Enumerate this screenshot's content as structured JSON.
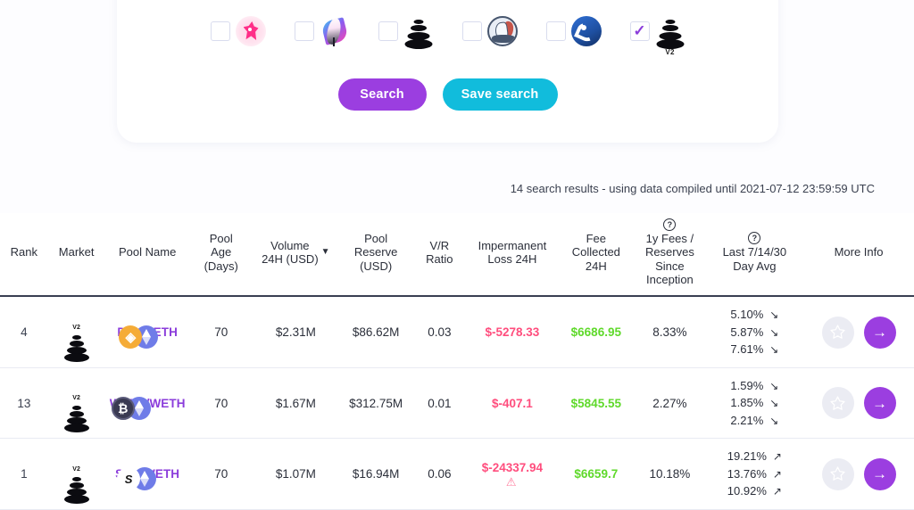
{
  "filter_panel": {
    "markets": [
      {
        "name": "uniswap-v2",
        "logo": "uniswap-logo",
        "checked": false,
        "version_tag": ""
      },
      {
        "name": "sushiswap",
        "logo": "sushiswap-logo",
        "checked": false,
        "version_tag": ""
      },
      {
        "name": "balancer-v1",
        "logo": "balancer-logo",
        "checked": false,
        "version_tag": ""
      },
      {
        "name": "dodo",
        "logo": "dodo-logo",
        "checked": false,
        "version_tag": ""
      },
      {
        "name": "bancor",
        "logo": "bancor-logo",
        "checked": false,
        "version_tag": ""
      },
      {
        "name": "balancer-v2",
        "logo": "balancer-logo",
        "checked": true,
        "version_tag": "V2"
      }
    ],
    "search_label": "Search",
    "save_search_label": "Save search"
  },
  "results_meta": "14 search results - using data compiled until 2021-07-12 23:59:59 UTC",
  "table": {
    "columns": [
      {
        "key": "rank",
        "label": "Rank",
        "help": false,
        "sorted": false
      },
      {
        "key": "market",
        "label": "Market",
        "help": false,
        "sorted": false
      },
      {
        "key": "pool_name",
        "label": "Pool Name",
        "help": false,
        "sorted": false
      },
      {
        "key": "pool_age",
        "label": "Pool\nAge\n(Days)",
        "help": false,
        "sorted": false
      },
      {
        "key": "volume_24h",
        "label": "Volume\n24H (USD)",
        "help": false,
        "sorted": true,
        "sort_caret": "▼"
      },
      {
        "key": "pool_reserve",
        "label": "Pool\nReserve\n(USD)",
        "help": false,
        "sorted": false
      },
      {
        "key": "vr_ratio",
        "label": "V/R\nRatio",
        "help": false,
        "sorted": false
      },
      {
        "key": "impermanent_loss",
        "label": "Impermanent\nLoss 24H",
        "help": false,
        "sorted": false
      },
      {
        "key": "fee_collected",
        "label": "Fee\nCollected\n24H",
        "help": false,
        "sorted": false
      },
      {
        "key": "fees_reserves",
        "label": "1y Fees /\nReserves\nSince\nInception",
        "help": true,
        "help_glyph": "?"
      },
      {
        "key": "last_avg",
        "label": "Last 7/14/30\nDay Avg",
        "help": true,
        "help_glyph": "?"
      },
      {
        "key": "more_info",
        "label": "More Info",
        "help": false,
        "sorted": false
      }
    ],
    "rows": [
      {
        "rank": "4",
        "market": "balancer-v2",
        "market_version": "V2",
        "pool_name": "DAI/WETH",
        "token_left": "DAI",
        "token_right": "WETH",
        "pool_age": "70",
        "volume_24h": "$2.31M",
        "pool_reserve": "$86.62M",
        "vr_ratio": "0.03",
        "impermanent_loss": "$-5278.33",
        "impermanent_warning": false,
        "fee_collected": "$6686.95",
        "fees_reserves": "8.33%",
        "avg7": "5.10%",
        "avg7_dir": "down",
        "avg14": "5.87%",
        "avg14_dir": "down",
        "avg30": "7.61%",
        "avg30_dir": "down",
        "favorited": false
      },
      {
        "rank": "13",
        "market": "balancer-v2",
        "market_version": "V2",
        "pool_name": "WBTC/WETH",
        "token_left": "WBTC",
        "token_right": "WETH",
        "pool_age": "70",
        "volume_24h": "$1.67M",
        "pool_reserve": "$312.75M",
        "vr_ratio": "0.01",
        "impermanent_loss": "$-407.1",
        "impermanent_warning": false,
        "fee_collected": "$5845.55",
        "fees_reserves": "2.27%",
        "avg7": "1.59%",
        "avg7_dir": "down",
        "avg14": "1.85%",
        "avg14_dir": "down",
        "avg30": "2.21%",
        "avg30_dir": "down",
        "favorited": false
      },
      {
        "rank": "1",
        "market": "balancer-v2",
        "market_version": "V2",
        "pool_name": "SNX/WETH",
        "token_left": "SNX",
        "token_right": "WETH",
        "pool_age": "70",
        "volume_24h": "$1.07M",
        "pool_reserve": "$16.94M",
        "vr_ratio": "0.06",
        "impermanent_loss": "$-24337.94",
        "impermanent_warning": true,
        "fee_collected": "$6659.7",
        "fees_reserves": "10.18%",
        "avg7": "19.21%",
        "avg7_dir": "up",
        "avg14": "13.76%",
        "avg14_dir": "up",
        "avg30": "10.92%",
        "avg30_dir": "up",
        "favorited": false
      }
    ]
  },
  "colors": {
    "accent_purple": "#9b3ee0",
    "accent_cyan": "#11bcdc",
    "negative": "#ff4d7d",
    "positive": "#5fd92b",
    "link": "#8b3ddb"
  }
}
